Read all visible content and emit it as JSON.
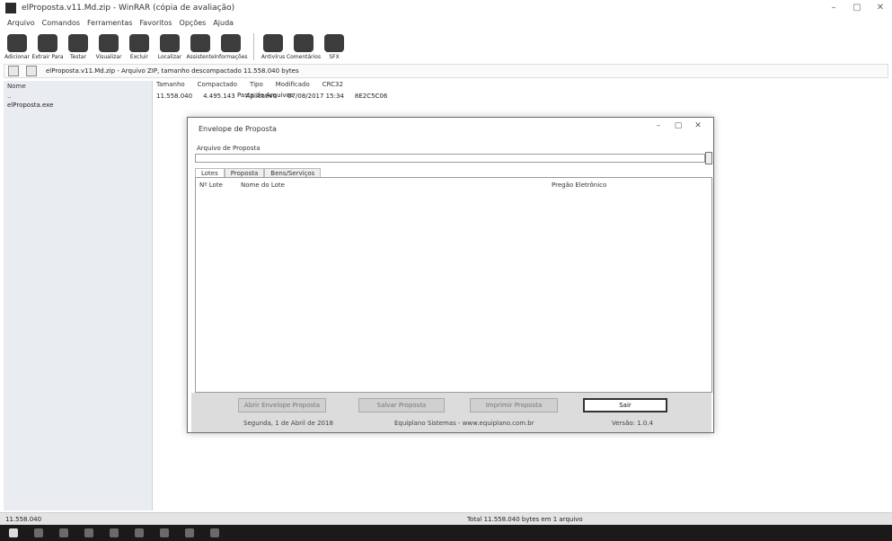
{
  "window": {
    "title": "elProposta.v11.Md.zip - WinRAR (cópia de avaliação)",
    "controls": [
      "–",
      "▢",
      "✕"
    ]
  },
  "menu": [
    "Arquivo",
    "Comandos",
    "Ferramentas",
    "Favoritos",
    "Opções",
    "Ajuda"
  ],
  "toolbar": [
    {
      "label": "Adicionar",
      "icon": "add-icon"
    },
    {
      "label": "Extrair Para",
      "icon": "extract-icon"
    },
    {
      "label": "Testar",
      "icon": "test-icon"
    },
    {
      "label": "Visualizar",
      "icon": "view-icon"
    },
    {
      "label": "Excluir",
      "icon": "delete-icon"
    },
    {
      "label": "Localizar",
      "icon": "find-icon"
    },
    {
      "label": "Assistente",
      "icon": "wizard-icon"
    },
    {
      "label": "Informações",
      "icon": "info-icon"
    },
    {
      "label": "Antivírus",
      "icon": "antivirus-icon"
    },
    {
      "label": "Comentários",
      "icon": "comment-icon"
    },
    {
      "label": "SFX",
      "icon": "sfx-icon"
    }
  ],
  "address": {
    "path": "elProposta.v11.Md.zip - Arquivo ZIP, tamanho descompactado 11.558.040 bytes"
  },
  "left_panel": {
    "header": "Nome",
    "items": [
      "..",
      "elProposta.exe"
    ]
  },
  "file_list": {
    "columns": [
      "Tamanho",
      "Compactado",
      "Tipo",
      "Modificado",
      "CRC32"
    ],
    "rows": [
      {
        "size": "11.558.040",
        "packed": "4.495.143",
        "type": "Aplicativo",
        "modified": "07/08/2017 15:34",
        "crc": "8E2C5C06"
      }
    ],
    "folder_row": {
      "type": "Pasta de Arquivos"
    }
  },
  "dialog": {
    "title": "Envelope de Proposta",
    "input_label": "Arquivo de Proposta",
    "input_value": "",
    "tabs": [
      "Lotes",
      "Proposta",
      "Bens/Serviços"
    ],
    "list_columns": [
      "Nº Lote",
      "Nome do Lote",
      "Pregão Eletrônico"
    ],
    "buttons": {
      "open": "Abrir Envelope Proposta",
      "save": "Salvar Proposta",
      "print": "Imprimir Proposta",
      "exit": "Sair"
    },
    "footer": {
      "date": "Segunda, 1 de Abril de 2018",
      "company": "Equiplano Sistemas - www.equiplano.com.br",
      "version": "Versão: 1.0.4"
    }
  },
  "status": {
    "left": "11.558.040",
    "center": "Total 11.558.040 bytes em 1 arquivo"
  }
}
